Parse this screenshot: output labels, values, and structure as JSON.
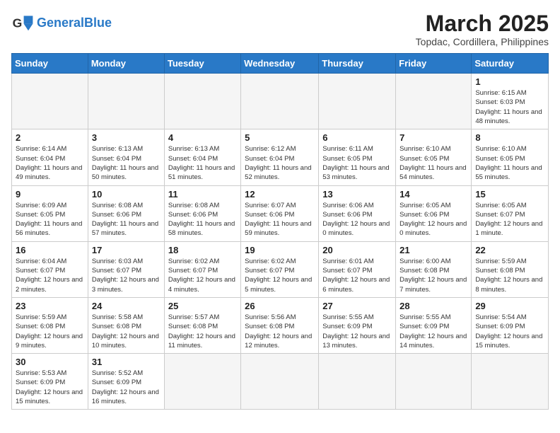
{
  "header": {
    "logo_general": "General",
    "logo_blue": "Blue",
    "month_year": "March 2025",
    "location": "Topdac, Cordillera, Philippines"
  },
  "days_of_week": [
    "Sunday",
    "Monday",
    "Tuesday",
    "Wednesday",
    "Thursday",
    "Friday",
    "Saturday"
  ],
  "weeks": [
    [
      {
        "day": "",
        "info": ""
      },
      {
        "day": "",
        "info": ""
      },
      {
        "day": "",
        "info": ""
      },
      {
        "day": "",
        "info": ""
      },
      {
        "day": "",
        "info": ""
      },
      {
        "day": "",
        "info": ""
      },
      {
        "day": "1",
        "info": "Sunrise: 6:15 AM\nSunset: 6:03 PM\nDaylight: 11 hours and 48 minutes."
      }
    ],
    [
      {
        "day": "2",
        "info": "Sunrise: 6:14 AM\nSunset: 6:04 PM\nDaylight: 11 hours and 49 minutes."
      },
      {
        "day": "3",
        "info": "Sunrise: 6:13 AM\nSunset: 6:04 PM\nDaylight: 11 hours and 50 minutes."
      },
      {
        "day": "4",
        "info": "Sunrise: 6:13 AM\nSunset: 6:04 PM\nDaylight: 11 hours and 51 minutes."
      },
      {
        "day": "5",
        "info": "Sunrise: 6:12 AM\nSunset: 6:04 PM\nDaylight: 11 hours and 52 minutes."
      },
      {
        "day": "6",
        "info": "Sunrise: 6:11 AM\nSunset: 6:05 PM\nDaylight: 11 hours and 53 minutes."
      },
      {
        "day": "7",
        "info": "Sunrise: 6:10 AM\nSunset: 6:05 PM\nDaylight: 11 hours and 54 minutes."
      },
      {
        "day": "8",
        "info": "Sunrise: 6:10 AM\nSunset: 6:05 PM\nDaylight: 11 hours and 55 minutes."
      }
    ],
    [
      {
        "day": "9",
        "info": "Sunrise: 6:09 AM\nSunset: 6:05 PM\nDaylight: 11 hours and 56 minutes."
      },
      {
        "day": "10",
        "info": "Sunrise: 6:08 AM\nSunset: 6:06 PM\nDaylight: 11 hours and 57 minutes."
      },
      {
        "day": "11",
        "info": "Sunrise: 6:08 AM\nSunset: 6:06 PM\nDaylight: 11 hours and 58 minutes."
      },
      {
        "day": "12",
        "info": "Sunrise: 6:07 AM\nSunset: 6:06 PM\nDaylight: 11 hours and 59 minutes."
      },
      {
        "day": "13",
        "info": "Sunrise: 6:06 AM\nSunset: 6:06 PM\nDaylight: 12 hours and 0 minutes."
      },
      {
        "day": "14",
        "info": "Sunrise: 6:05 AM\nSunset: 6:06 PM\nDaylight: 12 hours and 0 minutes."
      },
      {
        "day": "15",
        "info": "Sunrise: 6:05 AM\nSunset: 6:07 PM\nDaylight: 12 hours and 1 minute."
      }
    ],
    [
      {
        "day": "16",
        "info": "Sunrise: 6:04 AM\nSunset: 6:07 PM\nDaylight: 12 hours and 2 minutes."
      },
      {
        "day": "17",
        "info": "Sunrise: 6:03 AM\nSunset: 6:07 PM\nDaylight: 12 hours and 3 minutes."
      },
      {
        "day": "18",
        "info": "Sunrise: 6:02 AM\nSunset: 6:07 PM\nDaylight: 12 hours and 4 minutes."
      },
      {
        "day": "19",
        "info": "Sunrise: 6:02 AM\nSunset: 6:07 PM\nDaylight: 12 hours and 5 minutes."
      },
      {
        "day": "20",
        "info": "Sunrise: 6:01 AM\nSunset: 6:07 PM\nDaylight: 12 hours and 6 minutes."
      },
      {
        "day": "21",
        "info": "Sunrise: 6:00 AM\nSunset: 6:08 PM\nDaylight: 12 hours and 7 minutes."
      },
      {
        "day": "22",
        "info": "Sunrise: 5:59 AM\nSunset: 6:08 PM\nDaylight: 12 hours and 8 minutes."
      }
    ],
    [
      {
        "day": "23",
        "info": "Sunrise: 5:59 AM\nSunset: 6:08 PM\nDaylight: 12 hours and 9 minutes."
      },
      {
        "day": "24",
        "info": "Sunrise: 5:58 AM\nSunset: 6:08 PM\nDaylight: 12 hours and 10 minutes."
      },
      {
        "day": "25",
        "info": "Sunrise: 5:57 AM\nSunset: 6:08 PM\nDaylight: 12 hours and 11 minutes."
      },
      {
        "day": "26",
        "info": "Sunrise: 5:56 AM\nSunset: 6:08 PM\nDaylight: 12 hours and 12 minutes."
      },
      {
        "day": "27",
        "info": "Sunrise: 5:55 AM\nSunset: 6:09 PM\nDaylight: 12 hours and 13 minutes."
      },
      {
        "day": "28",
        "info": "Sunrise: 5:55 AM\nSunset: 6:09 PM\nDaylight: 12 hours and 14 minutes."
      },
      {
        "day": "29",
        "info": "Sunrise: 5:54 AM\nSunset: 6:09 PM\nDaylight: 12 hours and 15 minutes."
      }
    ],
    [
      {
        "day": "30",
        "info": "Sunrise: 5:53 AM\nSunset: 6:09 PM\nDaylight: 12 hours and 15 minutes."
      },
      {
        "day": "31",
        "info": "Sunrise: 5:52 AM\nSunset: 6:09 PM\nDaylight: 12 hours and 16 minutes."
      },
      {
        "day": "",
        "info": ""
      },
      {
        "day": "",
        "info": ""
      },
      {
        "day": "",
        "info": ""
      },
      {
        "day": "",
        "info": ""
      },
      {
        "day": "",
        "info": ""
      }
    ]
  ]
}
